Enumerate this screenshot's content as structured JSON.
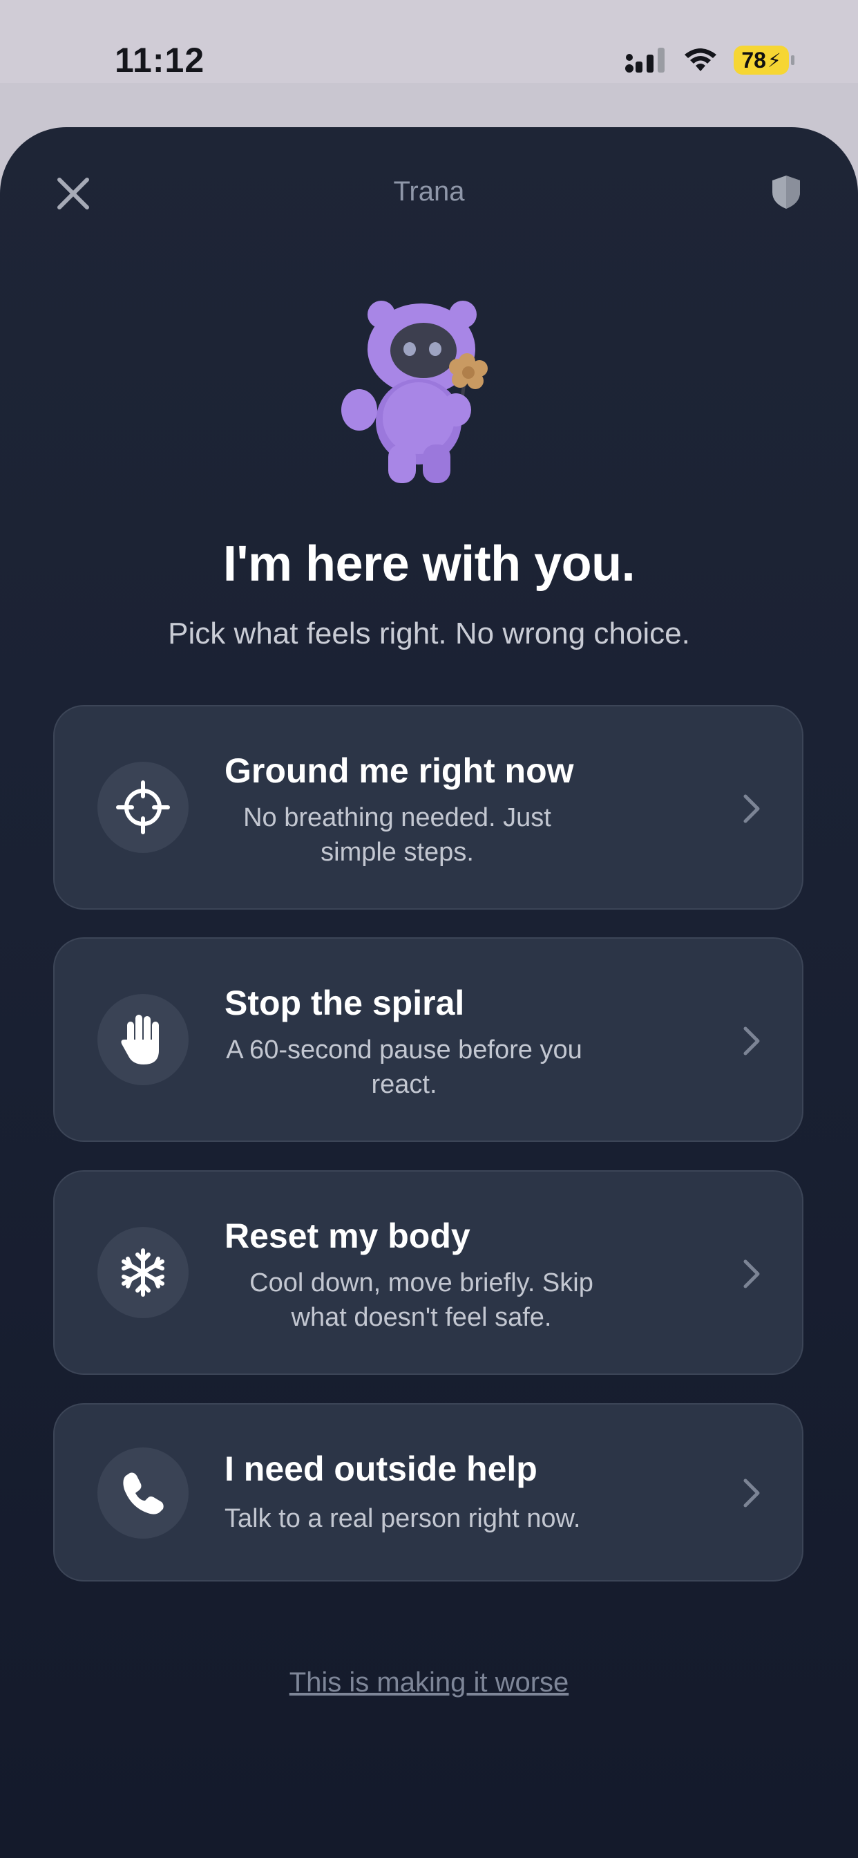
{
  "status_bar": {
    "time": "11:12",
    "battery": "78"
  },
  "header": {
    "title": "Trana",
    "close_icon": "close-icon",
    "shield_icon": "shield-icon"
  },
  "main": {
    "heading": "I'm here with you.",
    "subheading": "Pick what feels right. No wrong choice."
  },
  "options": [
    {
      "icon": "crosshair-icon",
      "title": "Ground me right now",
      "description": "No breathing needed. Just simple steps."
    },
    {
      "icon": "hand-icon",
      "title": "Stop the spiral",
      "description": "A 60-second pause before you react."
    },
    {
      "icon": "snowflake-icon",
      "title": "Reset my body",
      "description": "Cool down, move briefly. Skip what doesn't feel safe."
    },
    {
      "icon": "phone-icon",
      "title": "I need outside help",
      "description": "Talk to a real person right now."
    }
  ],
  "footer": {
    "link": "This is making it worse"
  },
  "colors": {
    "sheet_bg": "#1a2133",
    "card_bg": "#2c3547",
    "mascot": "#a886e6",
    "flower": "#c99a62"
  }
}
